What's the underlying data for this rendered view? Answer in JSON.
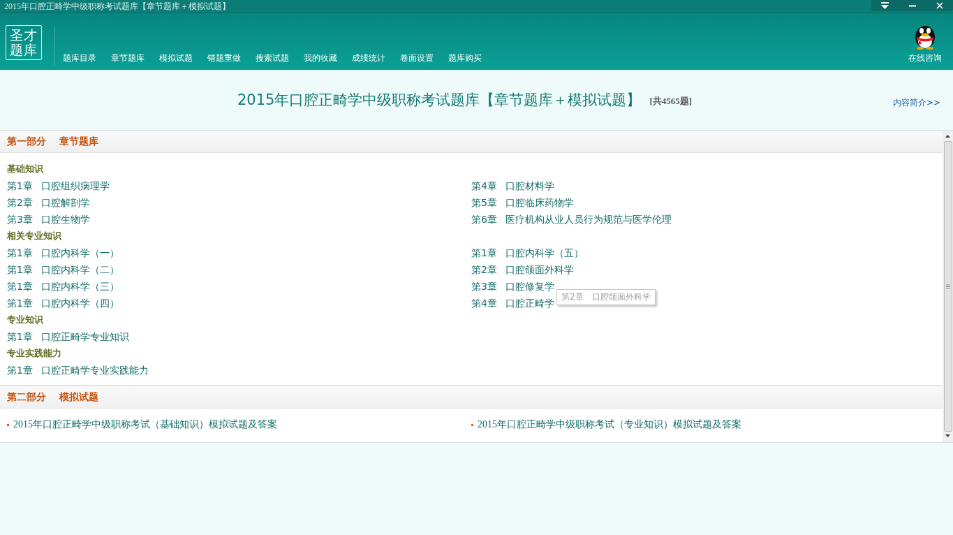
{
  "window": {
    "title": "2015年口腔正畸学中级职称考试题库【章节题库＋模拟试题】"
  },
  "logo": {
    "lines": [
      "圣才",
      "题库"
    ]
  },
  "nav": [
    "题库目录",
    "章节题库",
    "模拟试题",
    "错题重做",
    "搜索试题",
    "我的收藏",
    "成绩统计",
    "卷面设置",
    "题库购买"
  ],
  "consult": {
    "label": "在线咨询"
  },
  "heading": {
    "title": "2015年口腔正畸学中级职称考试题库【章节题库＋模拟试题】",
    "count": "[共4565题]",
    "link": "内容简介>>"
  },
  "sections": [
    {
      "kind": "chapters",
      "part": "第一部分",
      "name": "章节题库",
      "groups": [
        {
          "label": "基础知识",
          "left": [
            {
              "chapter": "第1章",
              "name": "口腔组织病理学"
            },
            {
              "chapter": "第2章",
              "name": "口腔解剖学"
            },
            {
              "chapter": "第3章",
              "name": "口腔生物学"
            }
          ],
          "right": [
            {
              "chapter": "第4章",
              "name": "口腔材料学"
            },
            {
              "chapter": "第5章",
              "name": "口腔临床药物学"
            },
            {
              "chapter": "第6章",
              "name": "医疗机构从业人员行为规范与医学伦理"
            }
          ]
        },
        {
          "label": "相关专业知识",
          "left": [
            {
              "chapter": "第1章",
              "name": "口腔内科学（一）"
            },
            {
              "chapter": "第1章",
              "name": "口腔内科学（二）"
            },
            {
              "chapter": "第1章",
              "name": "口腔内科学（三）"
            },
            {
              "chapter": "第1章",
              "name": "口腔内科学（四）"
            }
          ],
          "right": [
            {
              "chapter": "第1章",
              "name": "口腔内科学（五）"
            },
            {
              "chapter": "第2章",
              "name": "口腔颌面外科学"
            },
            {
              "chapter": "第3章",
              "name": "口腔修复学"
            },
            {
              "chapter": "第4章",
              "name": "口腔正畸学"
            }
          ]
        },
        {
          "label": "专业知识",
          "left": [
            {
              "chapter": "第1章",
              "name": "口腔正畸学专业知识"
            }
          ]
        },
        {
          "label": "专业实践能力",
          "left": [
            {
              "chapter": "第1章",
              "name": "口腔正畸学专业实践能力"
            }
          ]
        }
      ]
    },
    {
      "kind": "tests",
      "part": "第二部分",
      "name": "模拟试题",
      "items": [
        "2015年口腔正畸学中级职称考试（基础知识）模拟试题及答案",
        "2015年口腔正畸学中级职称考试（专业知识）模拟试题及答案"
      ]
    }
  ],
  "tooltip": {
    "chapter": "第2章",
    "name": "口腔颌面外科学"
  }
}
